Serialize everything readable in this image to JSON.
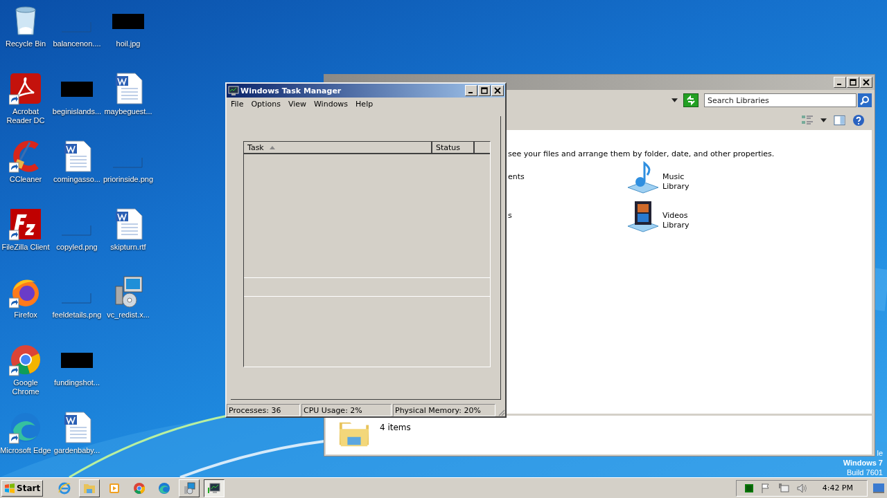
{
  "desktop_icons": [
    {
      "label": "Recycle Bin",
      "kind": "recycle-bin",
      "shortcut": false
    },
    {
      "label": "Acrobat Reader DC",
      "kind": "pdf",
      "shortcut": true
    },
    {
      "label": "CCleaner",
      "kind": "cleaner",
      "shortcut": true
    },
    {
      "label": "FileZilla Client",
      "kind": "ftp",
      "shortcut": true
    },
    {
      "label": "Firefox",
      "kind": "fox",
      "shortcut": true
    },
    {
      "label": "Google Chrome",
      "kind": "chrome",
      "shortcut": true
    },
    {
      "label": "Microsoft Edge",
      "kind": "edge",
      "shortcut": true
    },
    {
      "label": "balancenon....",
      "kind": "blank-image",
      "shortcut": false
    },
    {
      "label": "beginislands...",
      "kind": "dark-image",
      "shortcut": false
    },
    {
      "label": "comingasso...",
      "kind": "document",
      "shortcut": false
    },
    {
      "label": "copyled.png",
      "kind": "blank-image",
      "shortcut": false
    },
    {
      "label": "feeldetails.png",
      "kind": "blank-image",
      "shortcut": false
    },
    {
      "label": "fundingshot...",
      "kind": "dark-image",
      "shortcut": false
    },
    {
      "label": "gardenbaby...",
      "kind": "document",
      "shortcut": false
    },
    {
      "label": "hoil.jpg",
      "kind": "dark-image",
      "shortcut": false
    },
    {
      "label": "maybeguest...",
      "kind": "document",
      "shortcut": false
    },
    {
      "label": "priorinside.png",
      "kind": "blank-image",
      "shortcut": false
    },
    {
      "label": "skipturn.rtf",
      "kind": "document",
      "shortcut": false
    },
    {
      "label": "vc_redist.x...",
      "kind": "installer",
      "shortcut": false
    }
  ],
  "libraries_window": {
    "search": {
      "placeholder": "Search Libraries"
    },
    "description": "see your files and arrange them by folder, date, and other properties.",
    "items": [
      {
        "kind": "cut",
        "lines": [
          "ents"
        ]
      },
      {
        "kind": "music",
        "lines": [
          "Music",
          "Library"
        ]
      },
      {
        "kind": "cut",
        "lines": [
          "s"
        ]
      },
      {
        "kind": "videos",
        "lines": [
          "Videos",
          "Library"
        ]
      }
    ],
    "status": "4 items"
  },
  "task_manager": {
    "title": "Windows Task Manager",
    "menu": [
      "File",
      "Options",
      "View",
      "Windows",
      "Help"
    ],
    "columns": [
      {
        "label": "Task",
        "sorted": true
      },
      {
        "label": "Status",
        "sorted": false
      }
    ],
    "status_bar": [
      "Processes: 36",
      "CPU Usage: 2%",
      "Physical Memory: 20%"
    ]
  },
  "desktop_text": [
    "le",
    "Windows 7",
    "Build 7601"
  ],
  "taskbar": {
    "start": "Start",
    "apps": [
      {
        "kind": "ie",
        "framed": false,
        "selected": false
      },
      {
        "kind": "explorer",
        "framed": true,
        "selected": false
      },
      {
        "kind": "media",
        "framed": false,
        "selected": false
      },
      {
        "kind": "chrome",
        "framed": false,
        "selected": false
      },
      {
        "kind": "edge",
        "framed": false,
        "selected": false
      },
      {
        "kind": "installer",
        "framed": true,
        "selected": false
      },
      {
        "kind": "taskmgr",
        "framed": true,
        "selected": true
      }
    ],
    "clock": "4:42 PM"
  }
}
